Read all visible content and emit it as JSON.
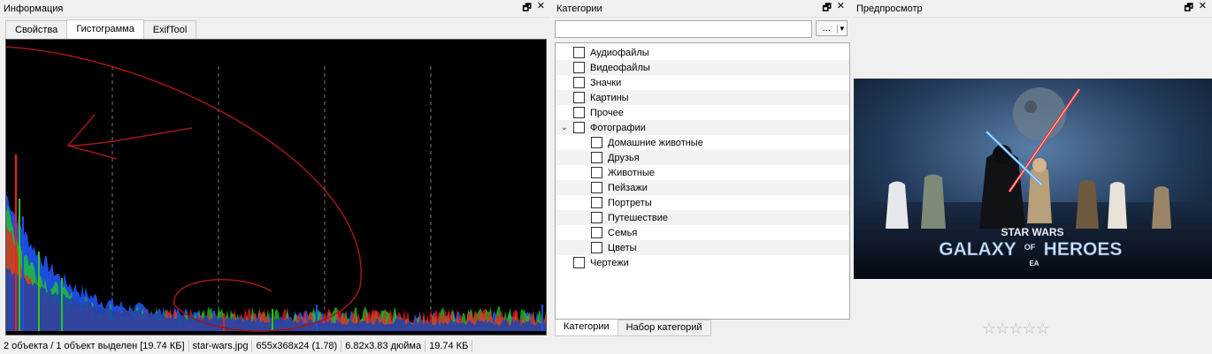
{
  "info": {
    "title": "Информация",
    "restore_glyph": "🗗",
    "close_glyph": "✕",
    "tabs": [
      {
        "label": "Свойства",
        "active": false
      },
      {
        "label": "Гистограмма",
        "active": true
      },
      {
        "label": "ExifTool",
        "active": false
      }
    ]
  },
  "histogram": {
    "background": "#000000",
    "colors": {
      "red": "#ff1a1a",
      "green": "#22cc22",
      "blue": "#1e50e6",
      "fill": "#2244aa"
    },
    "grid_lines": 4
  },
  "categories": {
    "title": "Категории",
    "restore_glyph": "🗗",
    "close_glyph": "✕",
    "search_value": "",
    "more_label": "...",
    "dropdown_glyph": "▼",
    "items": [
      {
        "label": "Аудиофайлы",
        "level": 0,
        "expandable": false
      },
      {
        "label": "Видеофайлы",
        "level": 0,
        "expandable": false
      },
      {
        "label": "Значки",
        "level": 0,
        "expandable": false
      },
      {
        "label": "Картины",
        "level": 0,
        "expandable": false
      },
      {
        "label": "Прочее",
        "level": 0,
        "expandable": false
      },
      {
        "label": "Фотографии",
        "level": 0,
        "expandable": true,
        "expander_glyph": "⌄"
      },
      {
        "label": "Домашние животные",
        "level": 1,
        "expandable": false
      },
      {
        "label": "Друзья",
        "level": 1,
        "expandable": false
      },
      {
        "label": "Животные",
        "level": 1,
        "expandable": false
      },
      {
        "label": "Пейзажи",
        "level": 1,
        "expandable": false
      },
      {
        "label": "Портреты",
        "level": 1,
        "expandable": false
      },
      {
        "label": "Путешествие",
        "level": 1,
        "expandable": false
      },
      {
        "label": "Семья",
        "level": 1,
        "expandable": false
      },
      {
        "label": "Цветы",
        "level": 1,
        "expandable": false
      },
      {
        "label": "Чертежи",
        "level": 0,
        "expandable": false
      }
    ],
    "bottom_tabs": [
      {
        "label": "Категории",
        "active": true
      },
      {
        "label": "Набор категорий",
        "active": false
      }
    ]
  },
  "preview": {
    "title": "Предпросмотр",
    "restore_glyph": "🗗",
    "close_glyph": "✕",
    "poster": {
      "line1": "STAR WARS",
      "line2": "GALAXY",
      "line2b": "OF",
      "line2c": "HEROES",
      "brand": "EA"
    },
    "rating": {
      "value": 0,
      "max": 5,
      "glyph": "☆"
    }
  },
  "status": {
    "selection": "2 объекта / 1 объект выделен [19.74 КБ]",
    "filename": "star-wars.jpg",
    "dimensions": "655x368x24 (1.78)",
    "print_size": "6.82x3.83 дюйма",
    "filesize": "19.74 КБ"
  }
}
